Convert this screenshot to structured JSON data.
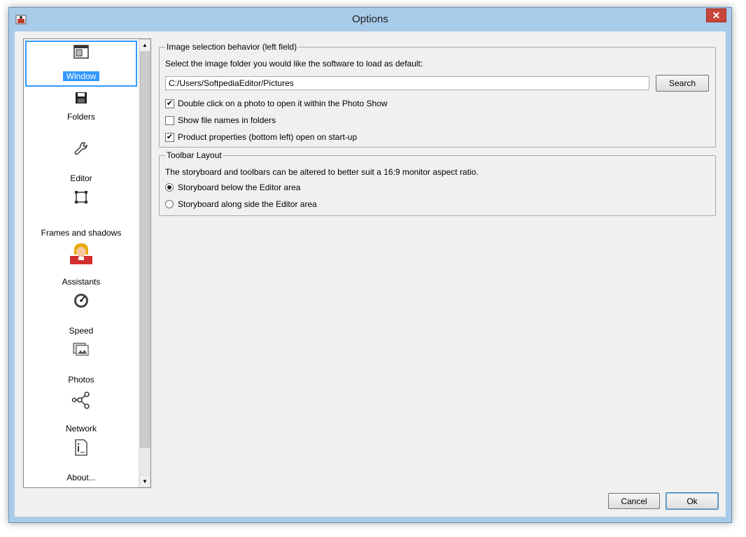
{
  "window": {
    "title": "Options",
    "close_glyph": "✕"
  },
  "nav": {
    "items": [
      {
        "label": "Window",
        "icon": "window-icon",
        "selected": true
      },
      {
        "label": "Folders",
        "icon": "floppy-disk-icon"
      },
      {
        "label": "Editor",
        "icon": "wrench-icon"
      },
      {
        "label": "Frames and shadows",
        "icon": "frame-icon"
      },
      {
        "label": "Assistants",
        "icon": "assistant-avatar-icon"
      },
      {
        "label": "Speed",
        "icon": "speedometer-icon"
      },
      {
        "label": "Photos",
        "icon": "photos-icon"
      },
      {
        "label": "Network",
        "icon": "network-icon"
      },
      {
        "label": "About...",
        "icon": "info-document-icon"
      }
    ]
  },
  "image_selection": {
    "title": "Image selection behavior (left field)",
    "prompt": "Select the image folder you would like the software to load as default:",
    "folder_path": "C:/Users/SoftpediaEditor/Pictures",
    "search_label": "Search",
    "options": [
      {
        "label": "Double click on a photo to open it within the Photo Show",
        "checked": true
      },
      {
        "label": "Show file names in folders",
        "checked": false
      },
      {
        "label": "Product properties (bottom left) open on start-up",
        "checked": true
      }
    ]
  },
  "toolbar_layout": {
    "title": "Toolbar Layout",
    "description": "The storyboard and toolbars can be altered to better suit a 16:9 monitor aspect ratio.",
    "options": [
      {
        "label": "Storyboard below the Editor area",
        "selected": true
      },
      {
        "label": "Storyboard along side the Editor area",
        "selected": false
      }
    ]
  },
  "footer": {
    "cancel_label": "Cancel",
    "ok_label": "Ok"
  },
  "colors": {
    "accent": "#3399ff",
    "titlebar": "#a9cbea",
    "close": "#c7463b"
  }
}
